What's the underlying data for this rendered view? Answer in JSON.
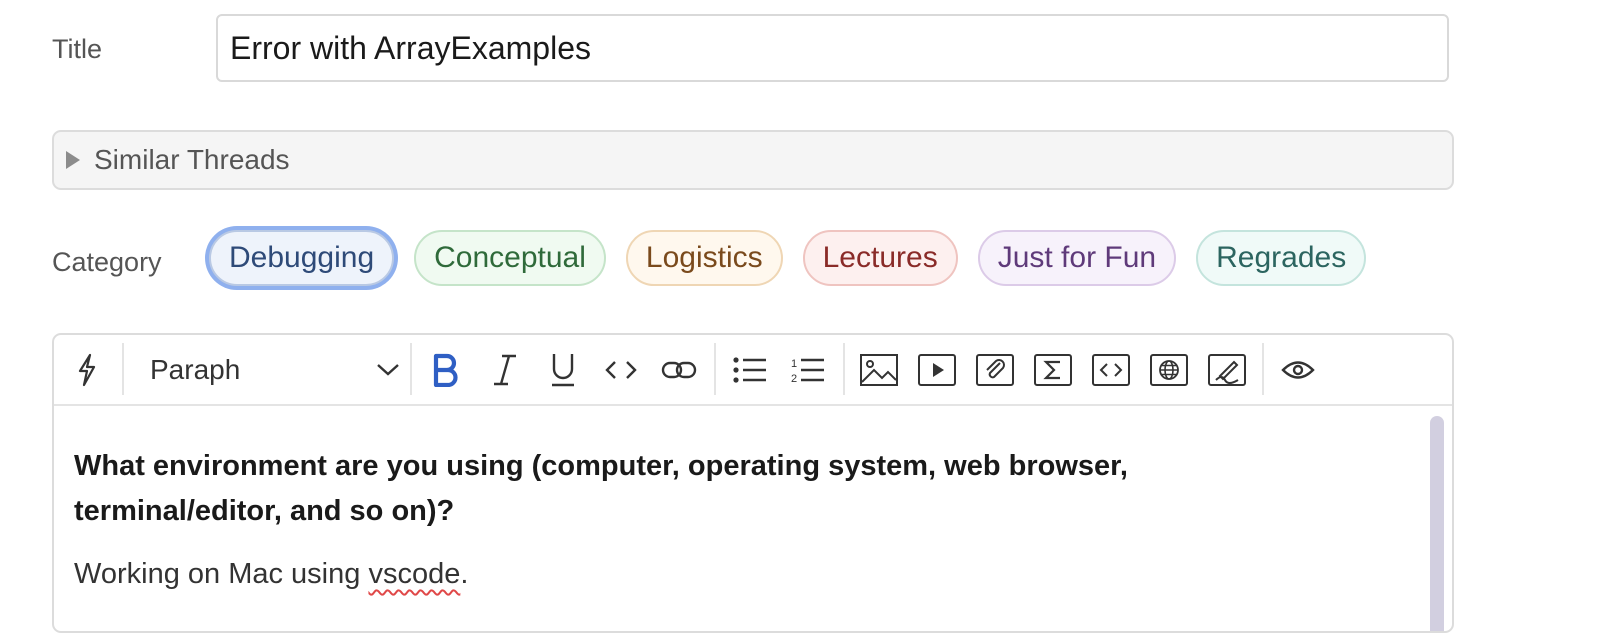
{
  "form": {
    "title_label": "Title",
    "title_value": "Error with ArrayExamples",
    "similar_threads_label": "Similar Threads",
    "category_label": "Category",
    "categories": [
      {
        "label": "Debugging",
        "selected": true,
        "color": "#2e4a78",
        "bg": "#eef3fb",
        "border": "#b9c9e4"
      },
      {
        "label": "Conceptual",
        "selected": false,
        "color": "#2f6a3a",
        "bg": "#f0faf1",
        "border": "#c5e4c9"
      },
      {
        "label": "Logistics",
        "selected": false,
        "color": "#7a4a1c",
        "bg": "#fff8ee",
        "border": "#efd6b4"
      },
      {
        "label": "Lectures",
        "selected": false,
        "color": "#8a2b28",
        "bg": "#fdf0ef",
        "border": "#efc4c0"
      },
      {
        "label": "Just for Fun",
        "selected": false,
        "color": "#5f3a7a",
        "bg": "#f7f2fb",
        "border": "#dccbe8"
      },
      {
        "label": "Regrades",
        "selected": false,
        "color": "#2c6560",
        "bg": "#f0faf8",
        "border": "#c4e4dd"
      }
    ]
  },
  "editor": {
    "toolbar": {
      "block_format": "Paraph",
      "items": [
        "lightning-icon",
        "bold-icon",
        "italic-icon",
        "underline-icon",
        "code-icon",
        "link-icon",
        "bullet-list-icon",
        "numbered-list-icon",
        "image-icon",
        "video-icon",
        "attachment-icon",
        "math-icon",
        "code-block-icon",
        "web-embed-icon",
        "drawing-icon",
        "preview-icon"
      ],
      "bold_color": "#2f5fc4"
    },
    "question": "What environment are you using (computer, operating system, web browser, terminal/editor, and so on)?",
    "answer_prefix": "Working on Mac using ",
    "answer_misspelled": "vscode",
    "answer_suffix": "."
  }
}
